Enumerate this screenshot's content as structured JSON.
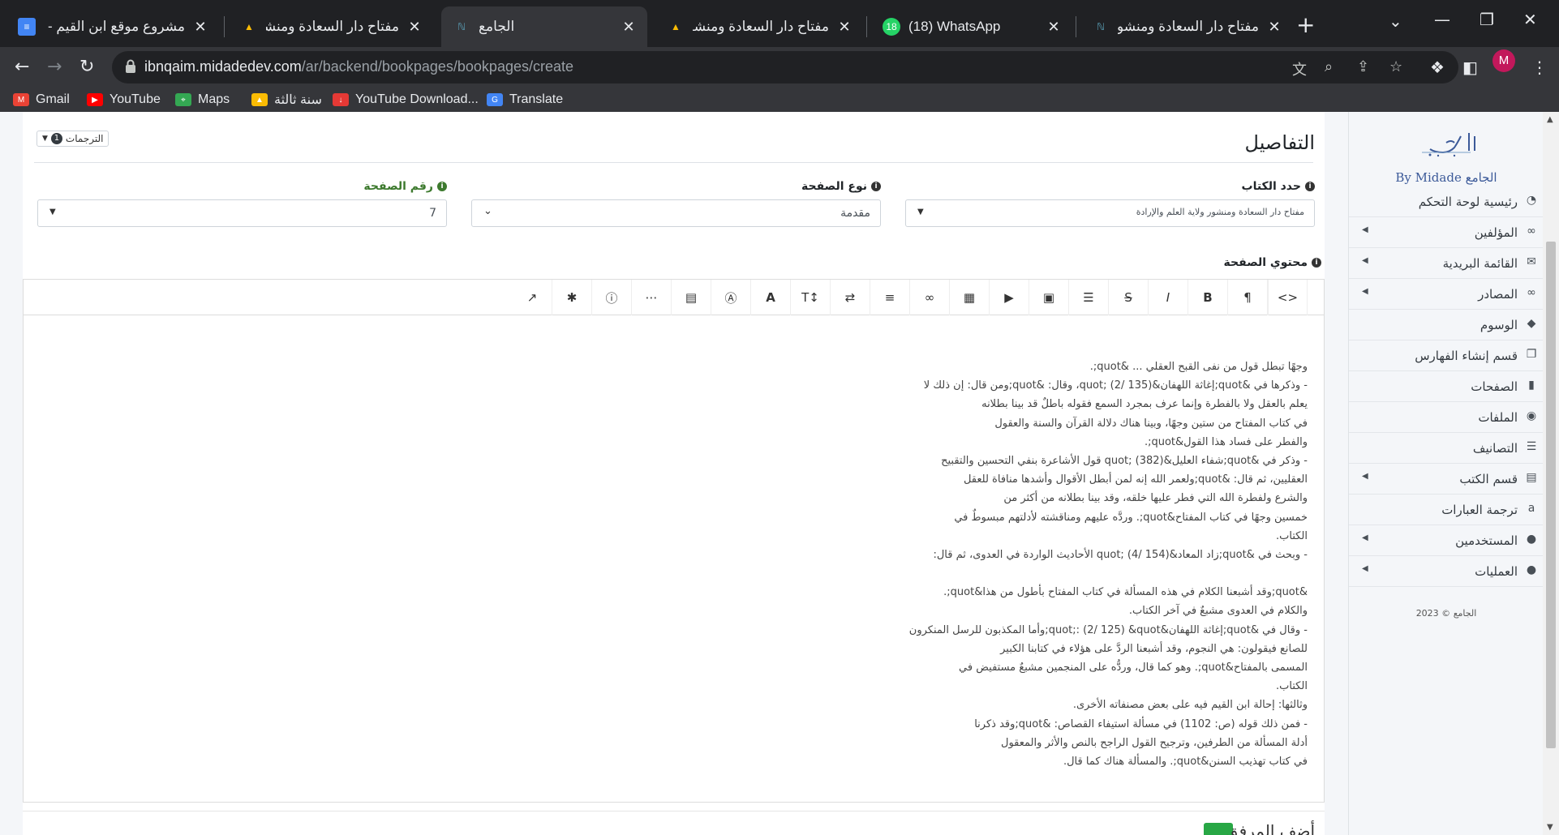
{
  "browser": {
    "tabs": [
      {
        "title": "مشروع موقع ابن القيم - مستن",
        "icon": "google-docs-icon",
        "active": false
      },
      {
        "title": "مفتاح دار السعادة ومنشور ولا",
        "icon": "google-drive-icon",
        "active": false
      },
      {
        "title": "الجامع",
        "icon": "site-logo-icon",
        "active": true
      },
      {
        "title": "مفتاح دار السعادة ومنشور ولا",
        "icon": "google-drive-icon",
        "active": false
      },
      {
        "title": "(18) WhatsApp",
        "icon": "whatsapp-icon",
        "active": false
      },
      {
        "title": "مفتاح دار السعادة ومنشور ولا",
        "icon": "site-logo-icon",
        "active": false
      }
    ],
    "url_host": "ibnqaim.midadedev.com",
    "url_path": "/ar/backend/bookpages/bookpages/create",
    "profile_initial": "M",
    "bookmarks": [
      {
        "label": "Gmail",
        "icon": "gmail-icon",
        "color": "#ea4335"
      },
      {
        "label": "YouTube",
        "icon": "youtube-icon",
        "color": "#ff0000"
      },
      {
        "label": "Maps",
        "icon": "maps-icon",
        "color": "#34a853"
      },
      {
        "label": "سنة ثالثة",
        "icon": "google-drive-icon",
        "color": "#fbbc04"
      },
      {
        "label": "YouTube Download...",
        "icon": "download-icon",
        "color": "#e53935"
      },
      {
        "label": "Translate",
        "icon": "translate-icon",
        "color": "#4285f4"
      }
    ]
  },
  "sidebar": {
    "brand": "By Midade الجامع",
    "items": [
      {
        "label": "رئيسية لوحة التحكم",
        "icon": "dashboard-icon",
        "has_children": false
      },
      {
        "label": "المؤلفين",
        "icon": "link-icon",
        "has_children": true
      },
      {
        "label": "القائمة البريدية",
        "icon": "mail-icon",
        "has_children": true
      },
      {
        "label": "المصادر",
        "icon": "link-icon",
        "has_children": true
      },
      {
        "label": "الوسوم",
        "icon": "tag-icon",
        "has_children": false
      },
      {
        "label": "قسم إنشاء الفهارس",
        "icon": "copy-icon",
        "has_children": false
      },
      {
        "label": "الصفحات",
        "icon": "file-icon",
        "has_children": false
      },
      {
        "label": "الملفات",
        "icon": "camera-icon",
        "has_children": false
      },
      {
        "label": "التصانيف",
        "icon": "layers-icon",
        "has_children": false
      },
      {
        "label": "قسم الكتب",
        "icon": "book-icon",
        "has_children": true
      },
      {
        "label": "ترجمة العبارات",
        "icon": "language-icon",
        "has_children": false
      },
      {
        "label": "المستخدمين",
        "icon": "user-icon",
        "has_children": true
      },
      {
        "label": "العمليات",
        "icon": "user-icon",
        "has_children": true
      }
    ],
    "footer": "2023 © الجامع"
  },
  "form": {
    "translations_label": "الترجمات",
    "translations_count": "1",
    "title": "التفاصيل",
    "book_label": "حدد الكتاب",
    "book_value": "مفتاح دار السعادة ومنشور ولاية العلم والإرادة",
    "type_label": "نوع الصفحة",
    "type_value": "مقدمة",
    "page_number_label": "رقم الصفحة",
    "page_number_value": "7",
    "content_label": "محتوي الصفحة",
    "label_colors": {
      "book": "#212529",
      "type": "#212529",
      "page_number": "#3d7a2e"
    }
  },
  "editor": {
    "toolbar": [
      "code-view-icon",
      "paragraph-icon",
      "bold-icon",
      "italic-icon",
      "strikethrough-icon",
      "list-icon",
      "image-icon",
      "video-icon",
      "table-icon",
      "link-icon",
      "align-icon",
      "text-direction-icon",
      "text-size-icon",
      "font-family-icon",
      "font-color-icon",
      "book-icon",
      "more-icon",
      "info-icon",
      "special-char-icon",
      "fullscreen-icon"
    ],
    "lines": [
      "وجهًا تبطل قول من نفى القبح العقلي ... &quot;.",
      "- وذكرها في &quot;إغاثة اللهفان&quot; (2/ 135)، وقال: &quot;ومن قال: إن ذلك لا",
      "يعلم بالعقل ولا بالفطرة وإنما عرف بمجرد السمع فقوله باطلٌ قد بينا بطلانه",
      "في كتاب المفتاح من ستين وجهًا، وبينا هناك دلالة القرآن والسنة والعقول",
      "والفطر على فساد هذا القول&quot;.",
      "- وذكر في &quot;شفاء العليل&quot; (382) قول الأشاعرة بنفي التحسين والتقبيح",
      "العقليين، ثم قال: &quot;ولعمر الله إنه لمن أبطل الأقوال وأشدها منافاة للعقل",
      "والشرع ولفطرة الله التي فطر عليها خلقه، وقد بينا بطلانه من أكثر من",
      "خمسين وجهًا في كتاب المفتاح&quot;. وردَّه عليهم ومناقشته لأدلتهم مبسوطٌ في",
      "الكتاب.",
      "- وبحث في &quot;زاد المعاد&quot; (4/ 154) الأحاديث الواردة في العدوى، ثم قال:",
      "",
      "&quot;وقد أشبعنا الكلام في هذه المسألة في كتاب المفتاح بأطول من هذا&quot;.",
      "والكلام في العدوى مشبعٌ في آخر الكتاب.",
      "- وقال في &quot;إغاثة اللهفان&quot;: (2/ 125) &quot;وأما المكذبون للرسل المنكرون",
      "للصانع فيقولون: هي النجوم، وقد أشبعنا الردَّ على هؤلاء في كتابنا الكبير",
      "المسمى بالمفتاح&quot;. وهو كما قال، وردُّه على المنجمين مشبعٌ مستفيض في",
      "الكتاب.",
      "وثالثها: إحالة ابن القيم فيه على بعض مصنفاته الأخرى.",
      "- فمن ذلك قوله (ص: 1102) في مسألة استيفاء القصاص: &quot;وقد ذكرنا",
      "أدلة المسألة من الطرفين، وترجيح القول الراجح بالنص والأثر والمعقول",
      "في كتاب تهذيب السنن&quot;. والمسألة هناك كما قال."
    ]
  },
  "next_section": {
    "label": "أضف المرفق"
  }
}
